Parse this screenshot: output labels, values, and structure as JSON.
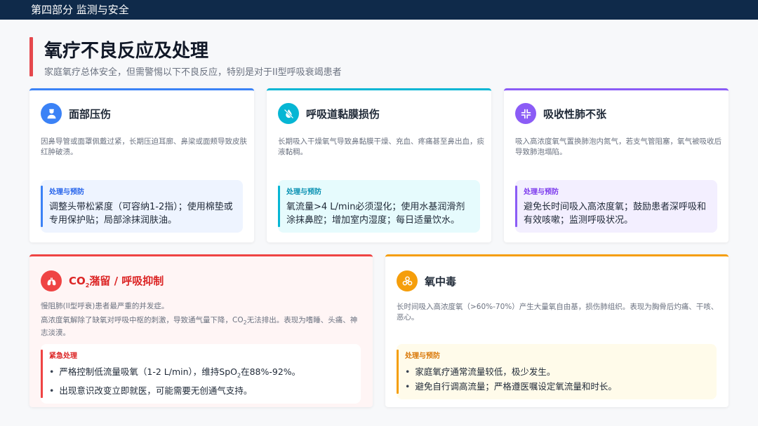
{
  "header": {
    "section": "第四部分 监测与安全"
  },
  "page": {
    "title": "氧疗不良反应及处理",
    "subtitle": "家庭氧疗总体安全，但需警惕以下不良反应，特别是对于II型呼吸衰竭患者"
  },
  "cards": {
    "pressure": {
      "title": "面部压伤",
      "icon": "user-nurse-icon",
      "accent": "#3b82f6",
      "description": "因鼻导管或面罩佩戴过紧，长期压迫耳廓、鼻梁或面颊导致皮肤红肿破溃。",
      "box_label": "处理与预防",
      "box_text": "调整头带松紧度（可容纳1-2指）；使用棉垫或专用保护贴；局部涂抹润肤油。"
    },
    "airway": {
      "title": "呼吸道黏膜损伤",
      "icon": "no-water-icon",
      "accent": "#06b6d4",
      "description": "长期吸入干燥氧气导致鼻黏膜干燥、充血、疼痛甚至鼻出血，痰液黏稠。",
      "box_label": "处理与预防",
      "box_text": "氧流量>4 L/min必须湿化；使用水基润滑剂涂抹鼻腔；增加室内湿度；每日适量饮水。"
    },
    "atelectasis": {
      "title": "吸收性肺不张",
      "icon": "compress-icon",
      "accent": "#8b5cf6",
      "description": "吸入高浓度氧气置换肺泡内氮气，若支气管阻塞，氧气被吸收后导致肺泡塌陷。",
      "box_label": "处理与预防",
      "box_text": "避免长时间吸入高浓度氧；鼓励患者深呼吸和有效咳嗽；监测呼吸状况。"
    },
    "co2": {
      "title_prefix": "CO",
      "title_sub": "2",
      "title_suffix": "潴留 / 呼吸抑制",
      "icon": "lungs-icon",
      "accent": "#ef4444",
      "desc1": "慢阻肺(II型呼衰)患者最严重的并发症。",
      "desc2_a": "高浓度氧解除了缺氧对呼吸中枢的刺激，导致通气量下降，CO",
      "desc2_sub": "2",
      "desc2_b": "无法排出。表现为嗜睡、头痛、神志淡漠。",
      "box_label": "紧急处理",
      "bullet1_a": "严格控制低流量吸氧（1-2 L/min），维持SpO",
      "bullet1_sub": "2",
      "bullet1_b": "在88%-92%。",
      "bullet2": "出现意识改变立即就医，可能需要无创通气支持。"
    },
    "toxicity": {
      "title": "氧中毒",
      "icon": "biohazard-icon",
      "accent": "#f59e0b",
      "description": "长时间吸入高浓度氧（>60%-70%）产生大量氧自由基，损伤肺组织。表现为胸骨后灼痛、干咳、恶心。",
      "box_label": "处理与预防",
      "bullet1": "家庭氧疗通常流量较低，极少发生。",
      "bullet2": "避免自行调高流量；严格遵医嘱设定氧流量和时长。"
    }
  }
}
